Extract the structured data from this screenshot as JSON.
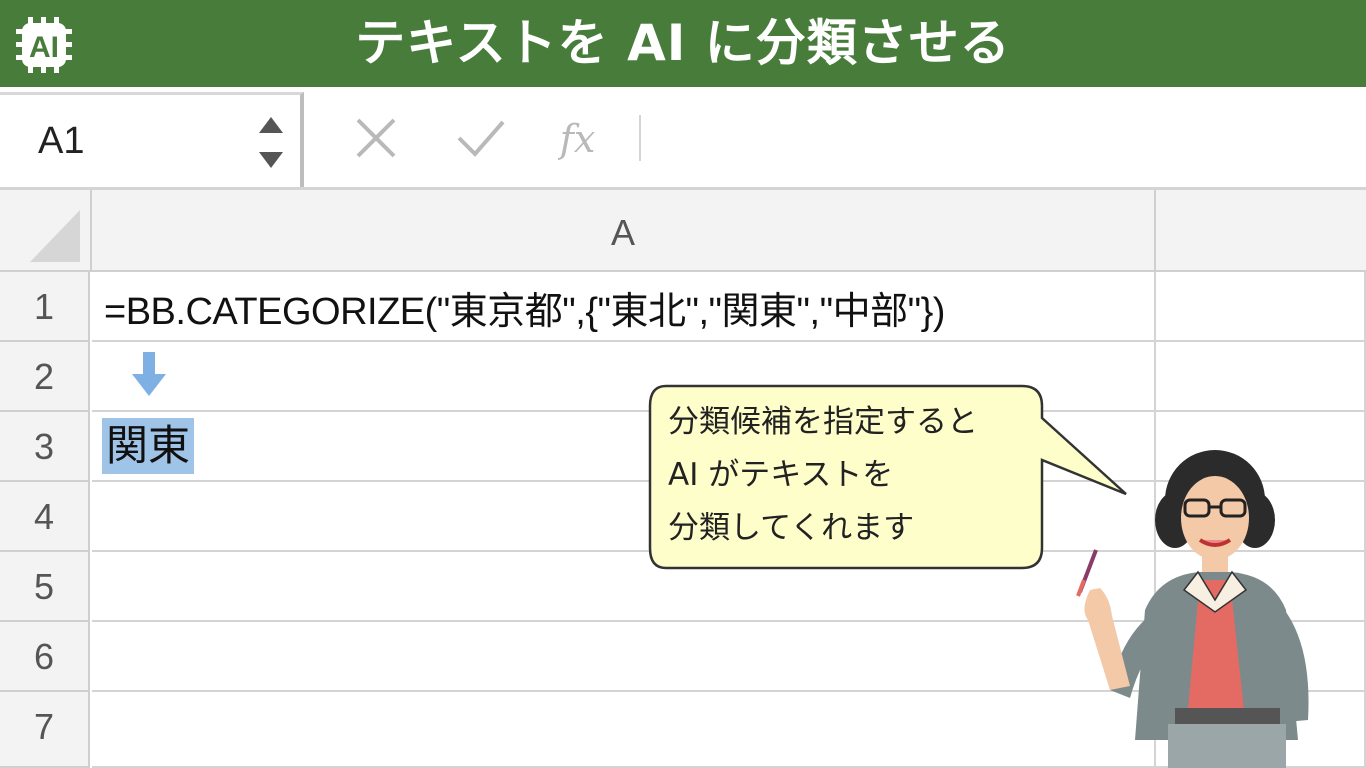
{
  "banner": {
    "logo_text": "AI",
    "title": "テキストを AI に分類させる"
  },
  "formula_bar": {
    "name_box": "A1",
    "cancel_icon": "close-icon",
    "enter_icon": "check-icon",
    "fx_label": "fx",
    "formula": ""
  },
  "sheet": {
    "columns": [
      "A"
    ],
    "rows": [
      "1",
      "2",
      "3",
      "4",
      "5",
      "6",
      "7"
    ],
    "cells": {
      "A1": "=BB.CATEGORIZE(\"東京都\",{\"東北\",\"関東\",\"中部\"})",
      "A3": "関東"
    },
    "arrow_icon": "down-arrow-icon",
    "selection_color": "#9fc4e8"
  },
  "callout": {
    "lines": [
      "分類候補を指定すると",
      "AI がテキストを",
      "分類してくれます"
    ]
  },
  "colors": {
    "banner": "#477c3a",
    "callout_fill": "#fefecb"
  }
}
